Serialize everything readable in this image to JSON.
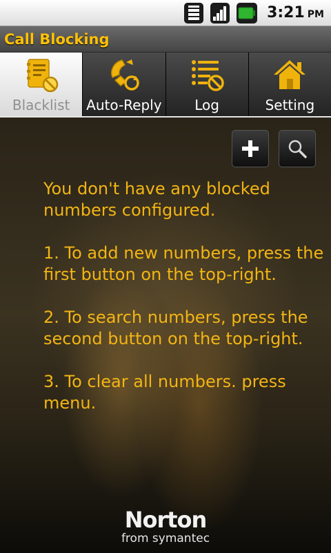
{
  "status_bar": {
    "time": "3:21",
    "ampm": "PM"
  },
  "app": {
    "title": "Call Blocking"
  },
  "tabs": [
    {
      "label": "Blacklist",
      "icon": "blacklist-icon",
      "active": true
    },
    {
      "label": "Auto-Reply",
      "icon": "auto-reply-icon",
      "active": false
    },
    {
      "label": "Log",
      "icon": "log-icon",
      "active": false
    },
    {
      "label": "Setting",
      "icon": "home-icon",
      "active": false
    }
  ],
  "actions": {
    "add_icon": "plus-icon",
    "search_icon": "search-icon"
  },
  "instructions": {
    "empty_message": "You don't have any blocked numbers configured.",
    "step1": " 1. To add new numbers, press the first button on the top-right.",
    "step2": " 2. To search numbers, press the second button on the top-right.",
    "step3": " 3. To clear all numbers. press menu."
  },
  "branding": {
    "name": "Norton",
    "subtitle": "from symantec"
  },
  "colors": {
    "accent": "#f3b514",
    "title": "#ffc107"
  }
}
